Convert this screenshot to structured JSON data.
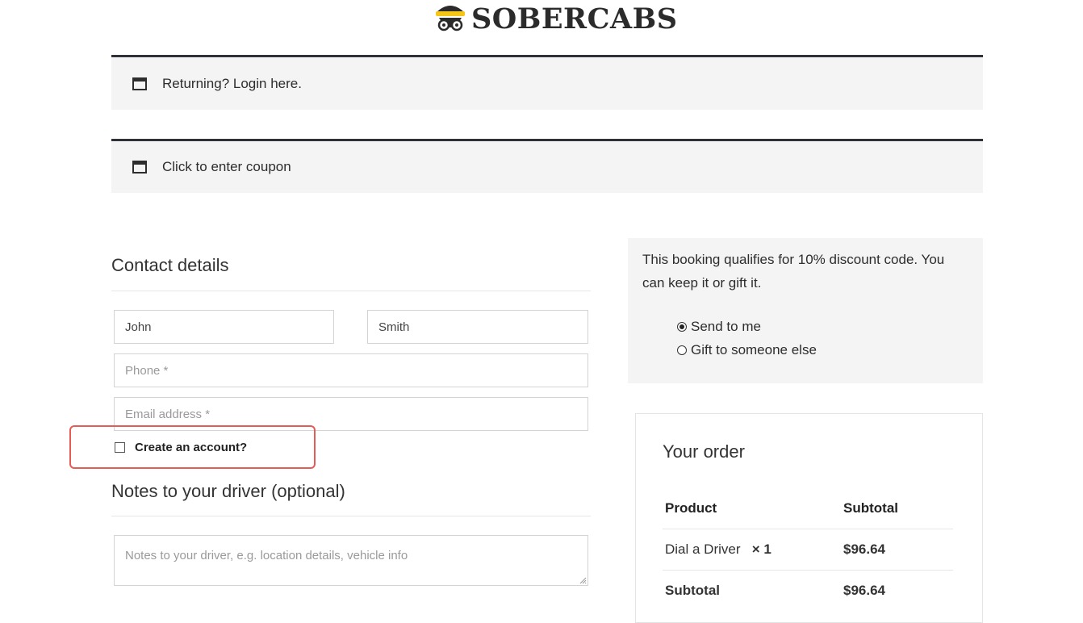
{
  "brand": {
    "name": "SOBERCABS"
  },
  "notices": {
    "login": "Returning? Login here.",
    "coupon": "Click to enter coupon"
  },
  "contact": {
    "title": "Contact details",
    "first_name_value": "John",
    "last_name_value": "Smith",
    "phone_placeholder": "Phone *",
    "email_placeholder": "Email address *",
    "create_account_label": "Create an account?"
  },
  "notes": {
    "title": "Notes to your driver (optional)",
    "placeholder": "Notes to your driver, e.g. location details, vehicle info"
  },
  "discount": {
    "message": "This booking qualifies for 10% discount code. You can keep it or gift it.",
    "options": [
      {
        "label": "Send to me",
        "checked": true
      },
      {
        "label": "Gift to someone else",
        "checked": false
      }
    ]
  },
  "order": {
    "title": "Your order",
    "headers": {
      "product": "Product",
      "subtotal": "Subtotal"
    },
    "items": [
      {
        "name": "Dial a Driver",
        "qty": "× 1",
        "price": "$96.64"
      }
    ],
    "subtotal": {
      "label": "Subtotal",
      "value": "$96.64"
    }
  },
  "colors": {
    "highlight": "#e85a55",
    "notice_border": "#2e3238",
    "panel_bg": "#f4f4f4",
    "logo_yellow": "#f5c518"
  }
}
